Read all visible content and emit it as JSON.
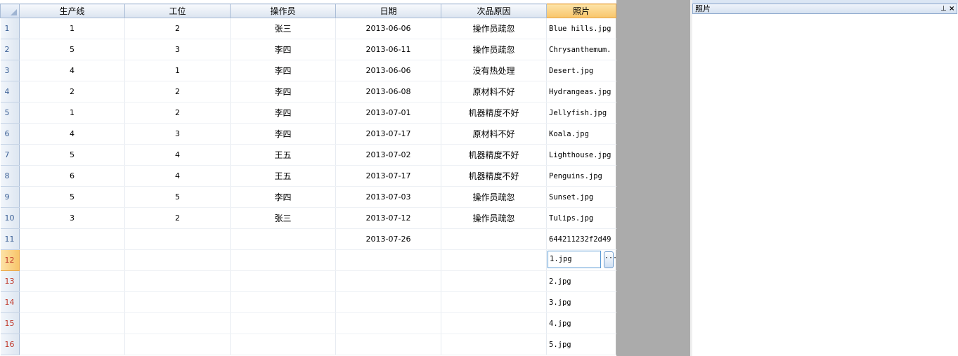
{
  "grid": {
    "columns": [
      "生产线",
      "工位",
      "操作员",
      "日期",
      "次品原因",
      "照片"
    ],
    "rows": [
      {
        "num": "1",
        "line": "1",
        "station": "2",
        "operator": "张三",
        "date": "2013-06-06",
        "reason": "操作员疏忽",
        "photo": "Blue hills.jpg"
      },
      {
        "num": "2",
        "line": "5",
        "station": "3",
        "operator": "李四",
        "date": "2013-06-11",
        "reason": "操作员疏忽",
        "photo": "Chrysanthemum."
      },
      {
        "num": "3",
        "line": "4",
        "station": "1",
        "operator": "李四",
        "date": "2013-06-06",
        "reason": "没有热处理",
        "photo": "Desert.jpg"
      },
      {
        "num": "4",
        "line": "2",
        "station": "2",
        "operator": "李四",
        "date": "2013-06-08",
        "reason": "原材料不好",
        "photo": "Hydrangeas.jpg"
      },
      {
        "num": "5",
        "line": "1",
        "station": "2",
        "operator": "李四",
        "date": "2013-07-01",
        "reason": "机器精度不好",
        "photo": "Jellyfish.jpg"
      },
      {
        "num": "6",
        "line": "4",
        "station": "3",
        "operator": "李四",
        "date": "2013-07-17",
        "reason": "原材料不好",
        "photo": "Koala.jpg"
      },
      {
        "num": "7",
        "line": "5",
        "station": "4",
        "operator": "王五",
        "date": "2013-07-02",
        "reason": "机器精度不好",
        "photo": "Lighthouse.jpg"
      },
      {
        "num": "8",
        "line": "6",
        "station": "4",
        "operator": "王五",
        "date": "2013-07-17",
        "reason": "机器精度不好",
        "photo": "Penguins.jpg"
      },
      {
        "num": "9",
        "line": "5",
        "station": "5",
        "operator": "李四",
        "date": "2013-07-03",
        "reason": "操作员疏忽",
        "photo": "Sunset.jpg"
      },
      {
        "num": "10",
        "line": "3",
        "station": "2",
        "operator": "张三",
        "date": "2013-07-12",
        "reason": "操作员疏忽",
        "photo": "Tulips.jpg"
      },
      {
        "num": "11",
        "line": "",
        "station": "",
        "operator": "",
        "date": "2013-07-26",
        "reason": "",
        "photo": "644211232f2d49"
      },
      {
        "num": "12",
        "line": "",
        "station": "",
        "operator": "",
        "date": "",
        "reason": "",
        "photo": "1.jpg"
      },
      {
        "num": "13",
        "line": "",
        "station": "",
        "operator": "",
        "date": "",
        "reason": "",
        "photo": "2.jpg"
      },
      {
        "num": "14",
        "line": "",
        "station": "",
        "operator": "",
        "date": "",
        "reason": "",
        "photo": "3.jpg"
      },
      {
        "num": "15",
        "line": "",
        "station": "",
        "operator": "",
        "date": "",
        "reason": "",
        "photo": "4.jpg"
      },
      {
        "num": "16",
        "line": "",
        "station": "",
        "operator": "",
        "date": "",
        "reason": "",
        "photo": "5.jpg"
      }
    ],
    "current_row": "12",
    "ellipsis_label": "···"
  },
  "panel": {
    "title": "照片",
    "pin_icon": "pin-icon",
    "pin_glyph": "⊥",
    "close_icon": "close-icon",
    "close_glyph": "×"
  },
  "colors": {
    "active_header": "#f8c56a",
    "row_number_red": "#c0392b",
    "empty_area": "#ababab",
    "editor_border": "#5b9bd5"
  }
}
